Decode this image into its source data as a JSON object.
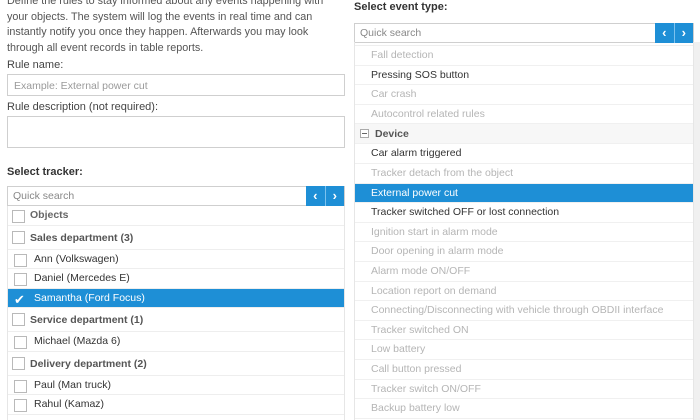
{
  "intro": "Define the rules to stay informed about any events happening with your objects. The system will log the events in real time and can instantly notify you once they happen. Afterwards you may look through all event records in table reports.",
  "rule_name": {
    "label": "Rule name:",
    "placeholder": "Example: External power cut"
  },
  "rule_desc": {
    "label": "Rule description (not required):"
  },
  "tracker": {
    "label": "Select tracker:",
    "search_placeholder": "Quick search",
    "prev": "‹",
    "next": "›",
    "rows": [
      {
        "text": "Objects",
        "kind": "head"
      },
      {
        "text": "Sales department (3)",
        "kind": "group"
      },
      {
        "text": "Ann (Volkswagen)",
        "kind": "item"
      },
      {
        "text": "Daniel (Mercedes E)",
        "kind": "item"
      },
      {
        "text": "Samantha (Ford Focus)",
        "kind": "item",
        "selected": true
      },
      {
        "text": "Service department (1)",
        "kind": "group"
      },
      {
        "text": "Michael (Mazda 6)",
        "kind": "item"
      },
      {
        "text": "Delivery department (2)",
        "kind": "group"
      },
      {
        "text": "Paul (Man truck)",
        "kind": "item"
      },
      {
        "text": "Rahul (Kamaz)",
        "kind": "item"
      }
    ]
  },
  "event": {
    "label": "Select event type:",
    "search_placeholder": "Quick search",
    "prev": "‹",
    "next": "›",
    "rows": [
      {
        "text": "",
        "kind": "cut"
      },
      {
        "text": "Fall detection",
        "kind": "dis"
      },
      {
        "text": "Pressing SOS button",
        "kind": "item"
      },
      {
        "text": "Car crash",
        "kind": "dis"
      },
      {
        "text": "Autocontrol related rules",
        "kind": "dis"
      },
      {
        "text": "Device",
        "kind": "sect"
      },
      {
        "text": "Car alarm triggered",
        "kind": "item"
      },
      {
        "text": "Tracker detach from the object",
        "kind": "dis"
      },
      {
        "text": "External power cut",
        "kind": "item",
        "selected": true
      },
      {
        "text": "Tracker switched OFF or lost connection",
        "kind": "item"
      },
      {
        "text": "Ignition start in alarm mode",
        "kind": "dis"
      },
      {
        "text": "Door opening in alarm mode",
        "kind": "dis"
      },
      {
        "text": "Alarm mode ON/OFF",
        "kind": "dis"
      },
      {
        "text": "Location report on demand",
        "kind": "dis"
      },
      {
        "text": "Connecting/Disconnecting with vehicle through OBDII interface",
        "kind": "dis"
      },
      {
        "text": "Tracker switched ON",
        "kind": "dis"
      },
      {
        "text": "Low battery",
        "kind": "dis"
      },
      {
        "text": "Call button pressed",
        "kind": "dis"
      },
      {
        "text": "Tracker switch ON/OFF",
        "kind": "dis"
      },
      {
        "text": "Backup battery low",
        "kind": "dis"
      }
    ]
  },
  "colors": {
    "accent": "#1e8fd6",
    "disabled_text": "#b5b5b5"
  }
}
